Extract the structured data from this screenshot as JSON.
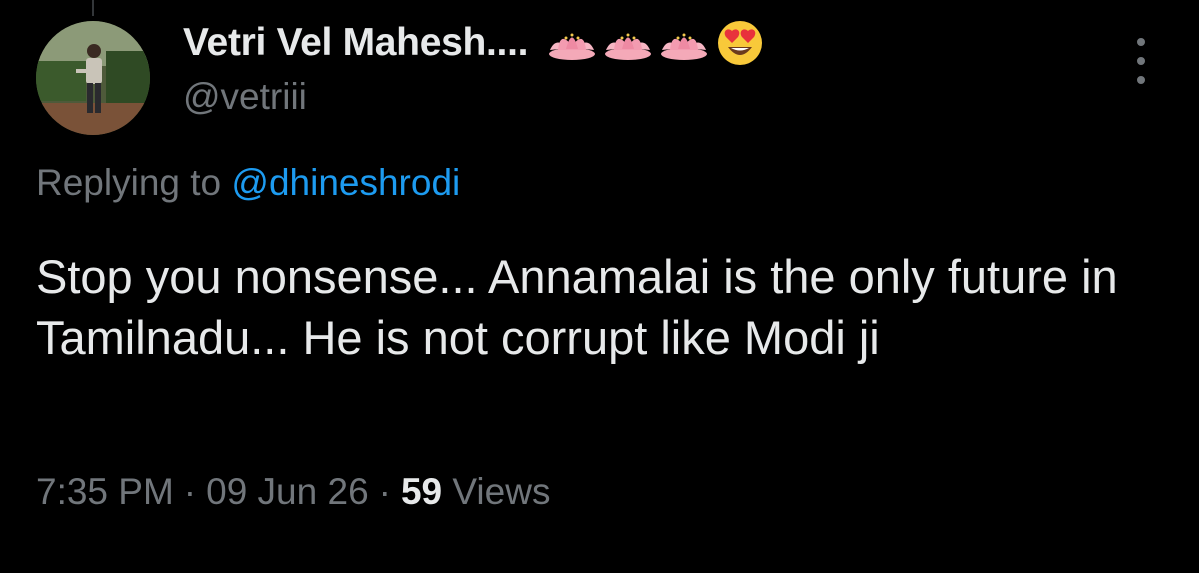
{
  "tweet": {
    "author": {
      "display_name": "Vetri Vel Mahesh....",
      "handle": "@vetriii",
      "name_emojis": [
        "lotus-icon",
        "lotus-icon",
        "lotus-icon",
        "heart-eyes-icon"
      ]
    },
    "replying_to": {
      "prefix": "Replying to",
      "mention": "@dhineshrodi"
    },
    "text": "Stop you nonsense... Annamalai is the only future in Tamilnadu... He is not corrupt like Modi ji",
    "meta": {
      "time": "7:35 PM",
      "separator": "·",
      "date": "09 Jun 26",
      "views_count": "59",
      "views_label": "Views"
    },
    "more_icon": "ellipsis-vertical-icon"
  },
  "colors": {
    "background": "#000000",
    "primary_text": "#e7e9ea",
    "secondary_text": "#71767b",
    "link": "#1d9bf0"
  }
}
